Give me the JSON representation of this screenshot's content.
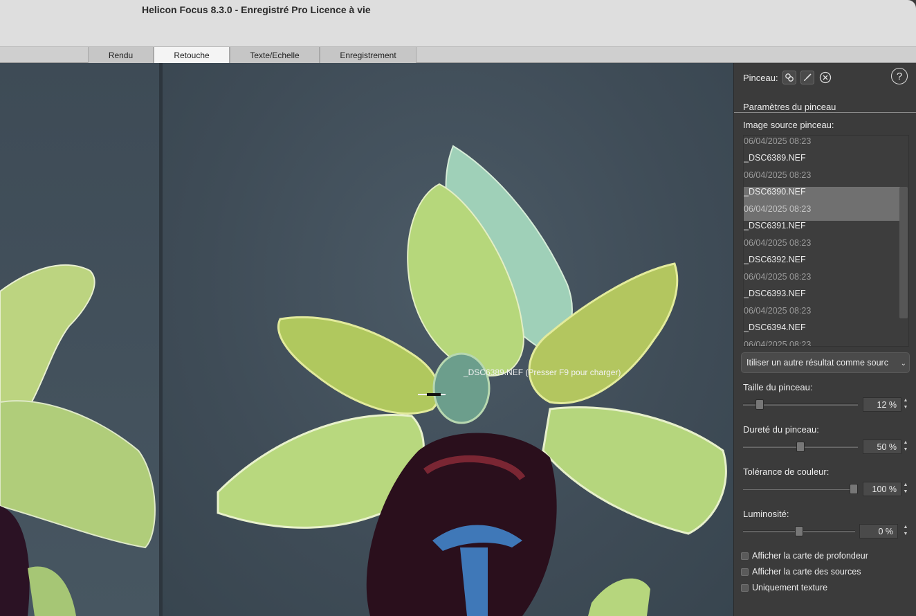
{
  "window": {
    "title": "Helicon Focus 8.3.0 - Enregistré Pro Licence à vie"
  },
  "tabs": [
    {
      "label": "Rendu"
    },
    {
      "label": "Retouche"
    },
    {
      "label": "Texte/Echelle"
    },
    {
      "label": "Enregistrement"
    }
  ],
  "active_tab": "Retouche",
  "viewport": {
    "hint": "_DSC6389.NEF (Presser F9 pour charger)"
  },
  "panel": {
    "brush_label": "Pinceau:",
    "brush_tools": [
      "clone-icon",
      "brush-icon",
      "erase-icon"
    ],
    "help": "?",
    "section_title": "Paramètres du pinceau",
    "source_label": "Image source pinceau:",
    "source_list": [
      {
        "name": "",
        "date": "06/04/2025 08:23"
      },
      {
        "name": "_DSC6389.NEF",
        "date": "06/04/2025 08:23"
      },
      {
        "name": "_DSC6390.NEF",
        "date": "06/04/2025 08:23",
        "selected": true
      },
      {
        "name": "_DSC6391.NEF",
        "date": "06/04/2025 08:23"
      },
      {
        "name": "_DSC6392.NEF",
        "date": "06/04/2025 08:23"
      },
      {
        "name": "_DSC6393.NEF",
        "date": "06/04/2025 08:23"
      },
      {
        "name": "_DSC6394.NEF",
        "date": "06/04/2025 08:23"
      }
    ],
    "dropdown_value": "Itiliser un autre résultat comme sourc",
    "sliders": [
      {
        "label": "Taille du pinceau:",
        "value_text": "12 %",
        "value": 0.12
      },
      {
        "label": "Dureté du pinceau:",
        "value_text": "50 %",
        "value": 0.5
      },
      {
        "label": "Tolérance de couleur:",
        "value_text": "100 %",
        "value": 1.0
      },
      {
        "label": "Luminosité:",
        "value_text": "0 %",
        "value": 0.5
      }
    ],
    "checkboxes": [
      {
        "label": "Afficher la carte de profondeur",
        "checked": false
      },
      {
        "label": "Afficher la carte des sources",
        "checked": false
      },
      {
        "label": "Uniquement texture",
        "checked": false
      }
    ]
  },
  "colors": {
    "panel_bg": "#3b3b3b",
    "viewport_bg": "#3f4c57",
    "selection": "#707070",
    "petal_green": "#b9d27a",
    "lip_dark": "#2a0f1c",
    "speculum_blue": "#3f78b8"
  }
}
